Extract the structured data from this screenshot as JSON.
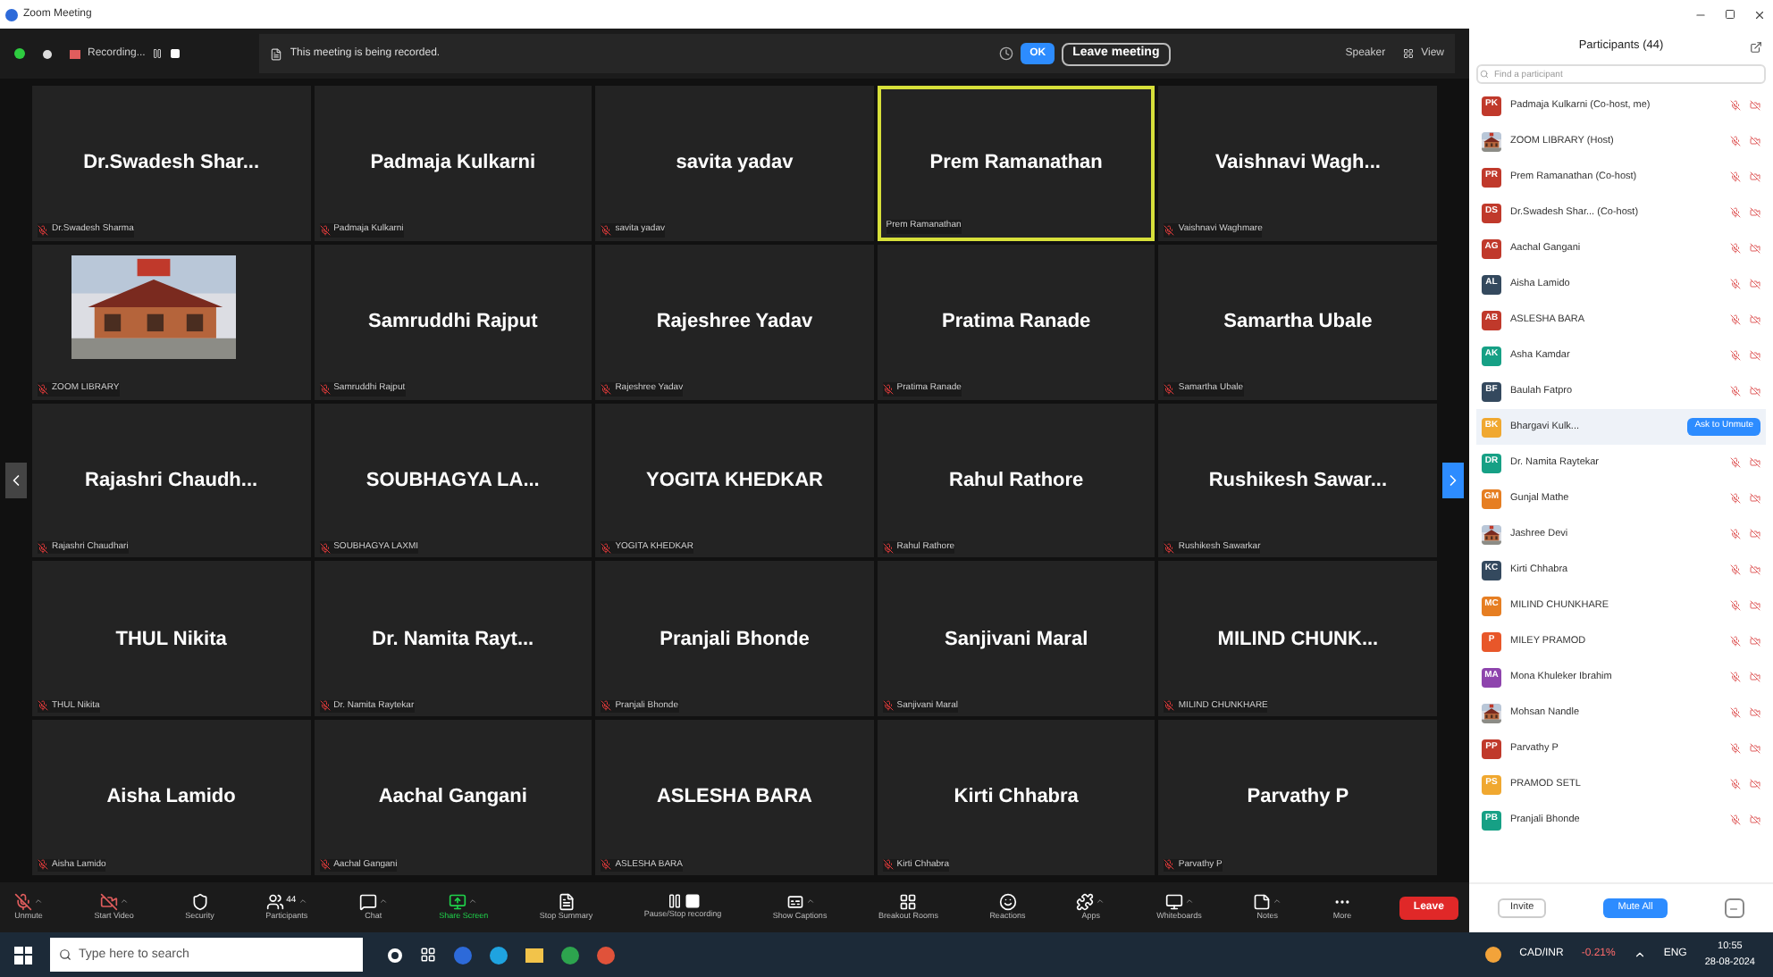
{
  "window": {
    "title": "Zoom Meeting"
  },
  "top_bar": {
    "recording": "Recording...",
    "notice": "This meeting is being recorded.",
    "ok": "OK",
    "leave": "Leave meeting",
    "speaker": "Speaker",
    "view": "View"
  },
  "tiles": [
    {
      "kind": "name",
      "name": "Dr.Swadesh Shar...",
      "label": "Dr.Swadesh Sharma",
      "muted": true,
      "active_speaker": false
    },
    {
      "kind": "name",
      "name": "Padmaja Kulkarni",
      "label": "Padmaja Kulkarni",
      "muted": true,
      "active_speaker": false
    },
    {
      "kind": "name",
      "name": "savita yadav",
      "label": "savita yadav",
      "muted": true,
      "active_speaker": false
    },
    {
      "kind": "name",
      "name": "Prem Ramanathan",
      "label": "Prem Ramanathan",
      "muted": false,
      "active_speaker": true
    },
    {
      "kind": "name",
      "name": "Vaishnavi Wagh...",
      "label": "Vaishnavi Waghmare",
      "muted": true,
      "active_speaker": false
    },
    {
      "kind": "picture",
      "label": "ZOOM LIBRARY",
      "muted": true,
      "active_speaker": false
    },
    {
      "kind": "name",
      "name": "Samruddhi Rajput",
      "label": "Samruddhi Rajput",
      "muted": true,
      "active_speaker": false
    },
    {
      "kind": "name",
      "name": "Rajeshree Yadav",
      "label": "Rajeshree Yadav",
      "muted": true,
      "active_speaker": false
    },
    {
      "kind": "name",
      "name": "Pratima Ranade",
      "label": "Pratima Ranade",
      "muted": true,
      "active_speaker": false
    },
    {
      "kind": "name",
      "name": "Samartha Ubale",
      "label": "Samartha Ubale",
      "muted": true,
      "active_speaker": false
    },
    {
      "kind": "name",
      "name": "Rajashri Chaudh...",
      "label": "Rajashri Chaudhari",
      "muted": true,
      "active_speaker": false
    },
    {
      "kind": "name",
      "name": "SOUBHAGYA LA...",
      "label": "SOUBHAGYA LAXMI",
      "muted": true,
      "active_speaker": false
    },
    {
      "kind": "name",
      "name": "YOGITA KHEDKAR",
      "label": "YOGITA KHEDKAR",
      "muted": true,
      "active_speaker": false
    },
    {
      "kind": "name",
      "name": "Rahul Rathore",
      "label": "Rahul Rathore",
      "muted": true,
      "active_speaker": false
    },
    {
      "kind": "name",
      "name": "Rushikesh Sawar...",
      "label": "Rushikesh Sawarkar",
      "muted": true,
      "active_speaker": false
    },
    {
      "kind": "name",
      "name": "THUL Nikita",
      "label": "THUL Nikita",
      "muted": true,
      "active_speaker": false
    },
    {
      "kind": "name",
      "name": "Dr. Namita Rayt...",
      "label": "Dr. Namita Raytekar",
      "muted": true,
      "active_speaker": false
    },
    {
      "kind": "name",
      "name": "Pranjali Bhonde",
      "label": "Pranjali Bhonde",
      "muted": true,
      "active_speaker": false
    },
    {
      "kind": "name",
      "name": "Sanjivani Maral",
      "label": "Sanjivani Maral",
      "muted": true,
      "active_speaker": false
    },
    {
      "kind": "name",
      "name": "MILIND CHUNK...",
      "label": "MILIND CHUNKHARE",
      "muted": true,
      "active_speaker": false
    },
    {
      "kind": "name",
      "name": "Aisha Lamido",
      "label": "Aisha Lamido",
      "muted": true,
      "active_speaker": false
    },
    {
      "kind": "name",
      "name": "Aachal Gangani",
      "label": "Aachal Gangani",
      "muted": true,
      "active_speaker": false
    },
    {
      "kind": "name",
      "name": "ASLESHA BARA",
      "label": "ASLESHA BARA",
      "muted": true,
      "active_speaker": false
    },
    {
      "kind": "name",
      "name": "Kirti Chhabra",
      "label": "Kirti Chhabra",
      "muted": true,
      "active_speaker": false
    },
    {
      "kind": "name",
      "name": "Parvathy P",
      "label": "Parvathy P",
      "muted": true,
      "active_speaker": false
    }
  ],
  "toolbar": [
    {
      "label": "Unmute",
      "kind": "mic",
      "caret": true
    },
    {
      "label": "Start Video",
      "kind": "video",
      "caret": true
    },
    {
      "label": "Security",
      "kind": "security",
      "caret": false
    },
    {
      "label": "Participants",
      "kind": "participants",
      "count": "44",
      "caret": true
    },
    {
      "label": "Chat",
      "kind": "chat",
      "caret": true
    },
    {
      "label": "Share Screen",
      "kind": "share",
      "caret": true
    },
    {
      "label": "Stop Summary",
      "kind": "summary",
      "caret": false
    },
    {
      "label": "Pause/Stop recording",
      "kind": "recording",
      "caret": false
    },
    {
      "label": "Show Captions",
      "kind": "captions",
      "caret": true
    },
    {
      "label": "Breakout Rooms",
      "kind": "rooms",
      "caret": false
    },
    {
      "label": "Reactions",
      "kind": "reactions",
      "caret": false
    },
    {
      "label": "Apps",
      "kind": "apps",
      "caret": true
    },
    {
      "label": "Whiteboards",
      "kind": "whiteboards",
      "caret": true
    },
    {
      "label": "Notes",
      "kind": "notes",
      "caret": true
    },
    {
      "label": "More",
      "kind": "more",
      "caret": false
    }
  ],
  "leave_button": "Leave",
  "panel": {
    "title": "Participants (44)",
    "search_placeholder": "Find a participant",
    "invite": "Invite",
    "mute_all": "Mute All"
  },
  "participants": [
    {
      "kind": "initials",
      "initials": "PK",
      "name": "Padmaja Kulkarni (Co-host, me)",
      "color": "#c0392b",
      "selected": false
    },
    {
      "kind": "picture",
      "name": "ZOOM LIBRARY (Host)",
      "selected": false
    },
    {
      "kind": "initials",
      "initials": "PR",
      "name": "Prem Ramanathan (Co-host)",
      "color": "#c0392b",
      "selected": false
    },
    {
      "kind": "initials",
      "initials": "DS",
      "name": "Dr.Swadesh Shar... (Co-host)",
      "color": "#c0392b",
      "selected": false
    },
    {
      "kind": "initials",
      "initials": "AG",
      "name": "Aachal Gangani",
      "color": "#c0392b",
      "selected": false
    },
    {
      "kind": "initials",
      "initials": "AL",
      "name": "Aisha Lamido",
      "color": "#34495e",
      "selected": false
    },
    {
      "kind": "initials",
      "initials": "AB",
      "name": "ASLESHA BARA",
      "color": "#c0392b",
      "selected": false
    },
    {
      "kind": "initials",
      "initials": "AK",
      "name": "Asha Kamdar",
      "color": "#16a085",
      "selected": false
    },
    {
      "kind": "initials",
      "initials": "BF",
      "name": "Baulah Fatpro",
      "color": "#34495e",
      "selected": false
    },
    {
      "kind": "initials",
      "initials": "BK",
      "name": "Bhargavi Kulk...",
      "color": "#f0a830",
      "action": "Ask to Unmute",
      "selected": true
    },
    {
      "kind": "initials",
      "initials": "DR",
      "name": "Dr. Namita Raytekar",
      "color": "#16a085",
      "selected": false
    },
    {
      "kind": "initials",
      "initials": "GM",
      "name": "Gunjal Mathe",
      "color": "#e67e22",
      "selected": false
    },
    {
      "kind": "picture",
      "name": "Jashree Devi",
      "selected": false
    },
    {
      "kind": "initials",
      "initials": "KC",
      "name": "Kirti Chhabra",
      "color": "#34495e",
      "selected": false
    },
    {
      "kind": "initials",
      "initials": "MC",
      "name": "MILIND CHUNKHARE",
      "color": "#e67e22",
      "selected": false
    },
    {
      "kind": "initials",
      "initials": "P",
      "name": "MILEY PRAMOD",
      "color": "#e8572a",
      "selected": false
    },
    {
      "kind": "initials",
      "initials": "MA",
      "name": "Mona Khuleker Ibrahim",
      "color": "#8e44ad",
      "selected": false
    },
    {
      "kind": "picture",
      "name": "Mohsan Nandle",
      "selected": false
    },
    {
      "kind": "initials",
      "initials": "PP",
      "name": "Parvathy P",
      "color": "#c0392b",
      "selected": false
    },
    {
      "kind": "initials",
      "initials": "PS",
      "name": "PRAMOD SETL",
      "color": "#f0a830",
      "selected": false
    },
    {
      "kind": "initials",
      "initials": "PB",
      "name": "Pranjali Bhonde",
      "color": "#16a085",
      "selected": false
    }
  ],
  "taskbar": {
    "search_placeholder": "Type here to search",
    "ticker": "CAD/INR",
    "change": "-0.21%",
    "language": "ENG",
    "time": "10:55",
    "date": "28-08-2024"
  }
}
